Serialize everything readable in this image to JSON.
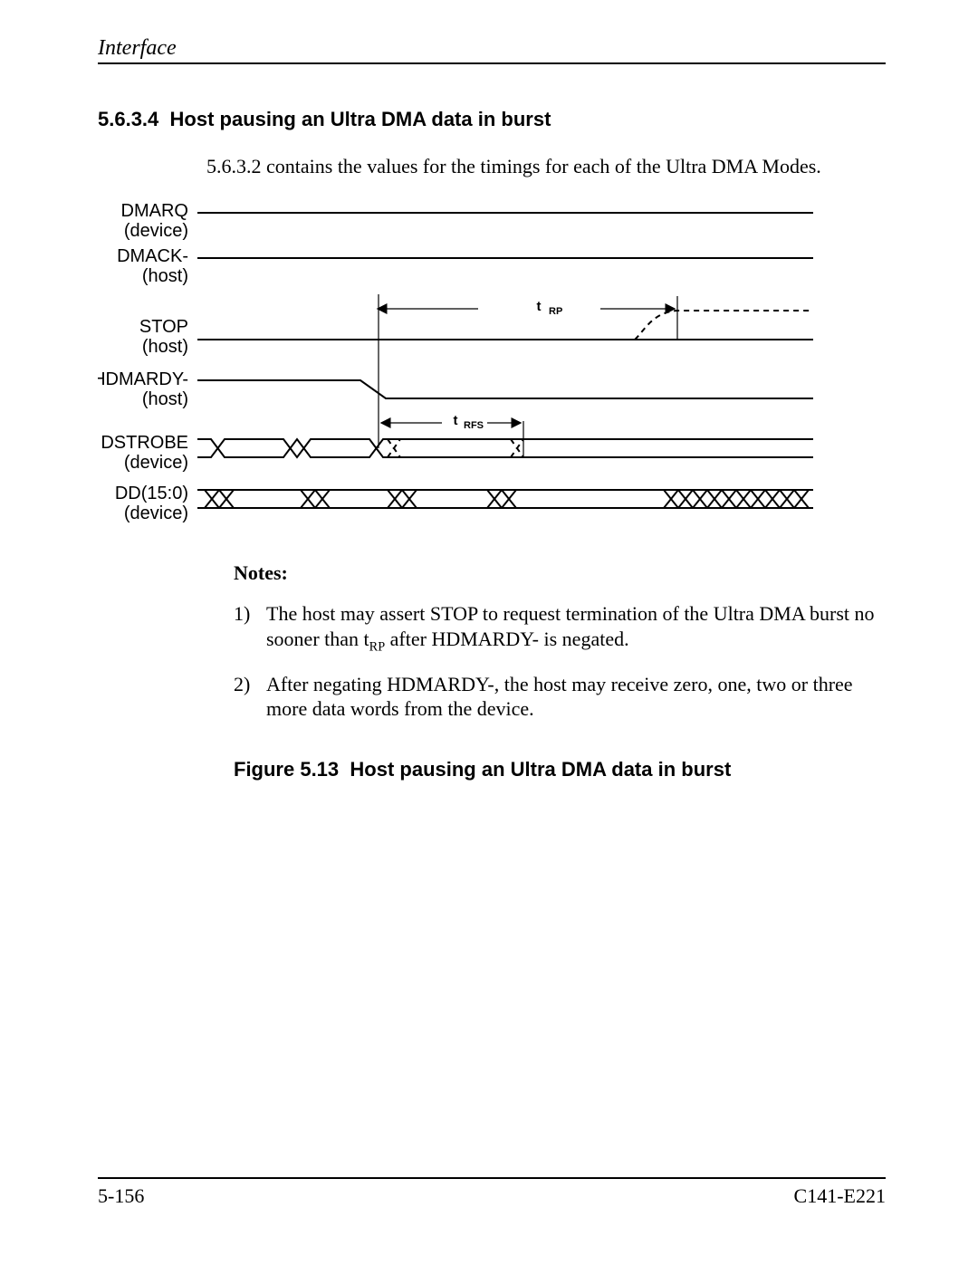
{
  "header": {
    "title": "Interface"
  },
  "section": {
    "number": "5.6.3.4",
    "title": "Host pausing an Ultra DMA data in burst",
    "lead": "5.6.3.2 contains the values for the timings for each of the Ultra DMA Modes."
  },
  "diagram": {
    "signals": [
      {
        "name": "DMARQ",
        "owner": "(device)"
      },
      {
        "name": "DMACK-",
        "owner": "(host)"
      },
      {
        "name": "STOP",
        "owner": "(host)"
      },
      {
        "name": "HDMARDY-",
        "owner": "(host)"
      },
      {
        "name": "DSTROBE",
        "owner": "(device)"
      },
      {
        "name": "DD(15:0)",
        "owner": "(device)"
      }
    ],
    "labels": {
      "t_rp": "tRP",
      "t_rfs": "tRFS"
    }
  },
  "notes": {
    "heading": "Notes:",
    "items": [
      {
        "num": "1)",
        "text_before": "The host may assert STOP to request termination of the Ultra DMA burst no sooner than t",
        "sub": "RP",
        "text_after": " after HDMARDY- is negated."
      },
      {
        "num": "2)",
        "text_before": "After negating HDMARDY-, the host may receive zero, one, two or three more data words from the device.",
        "sub": "",
        "text_after": ""
      }
    ]
  },
  "figure": {
    "label": "Figure 5.13",
    "caption": "Host pausing an Ultra DMA data in burst"
  },
  "footer": {
    "page": "5-156",
    "docid": "C141-E221"
  }
}
